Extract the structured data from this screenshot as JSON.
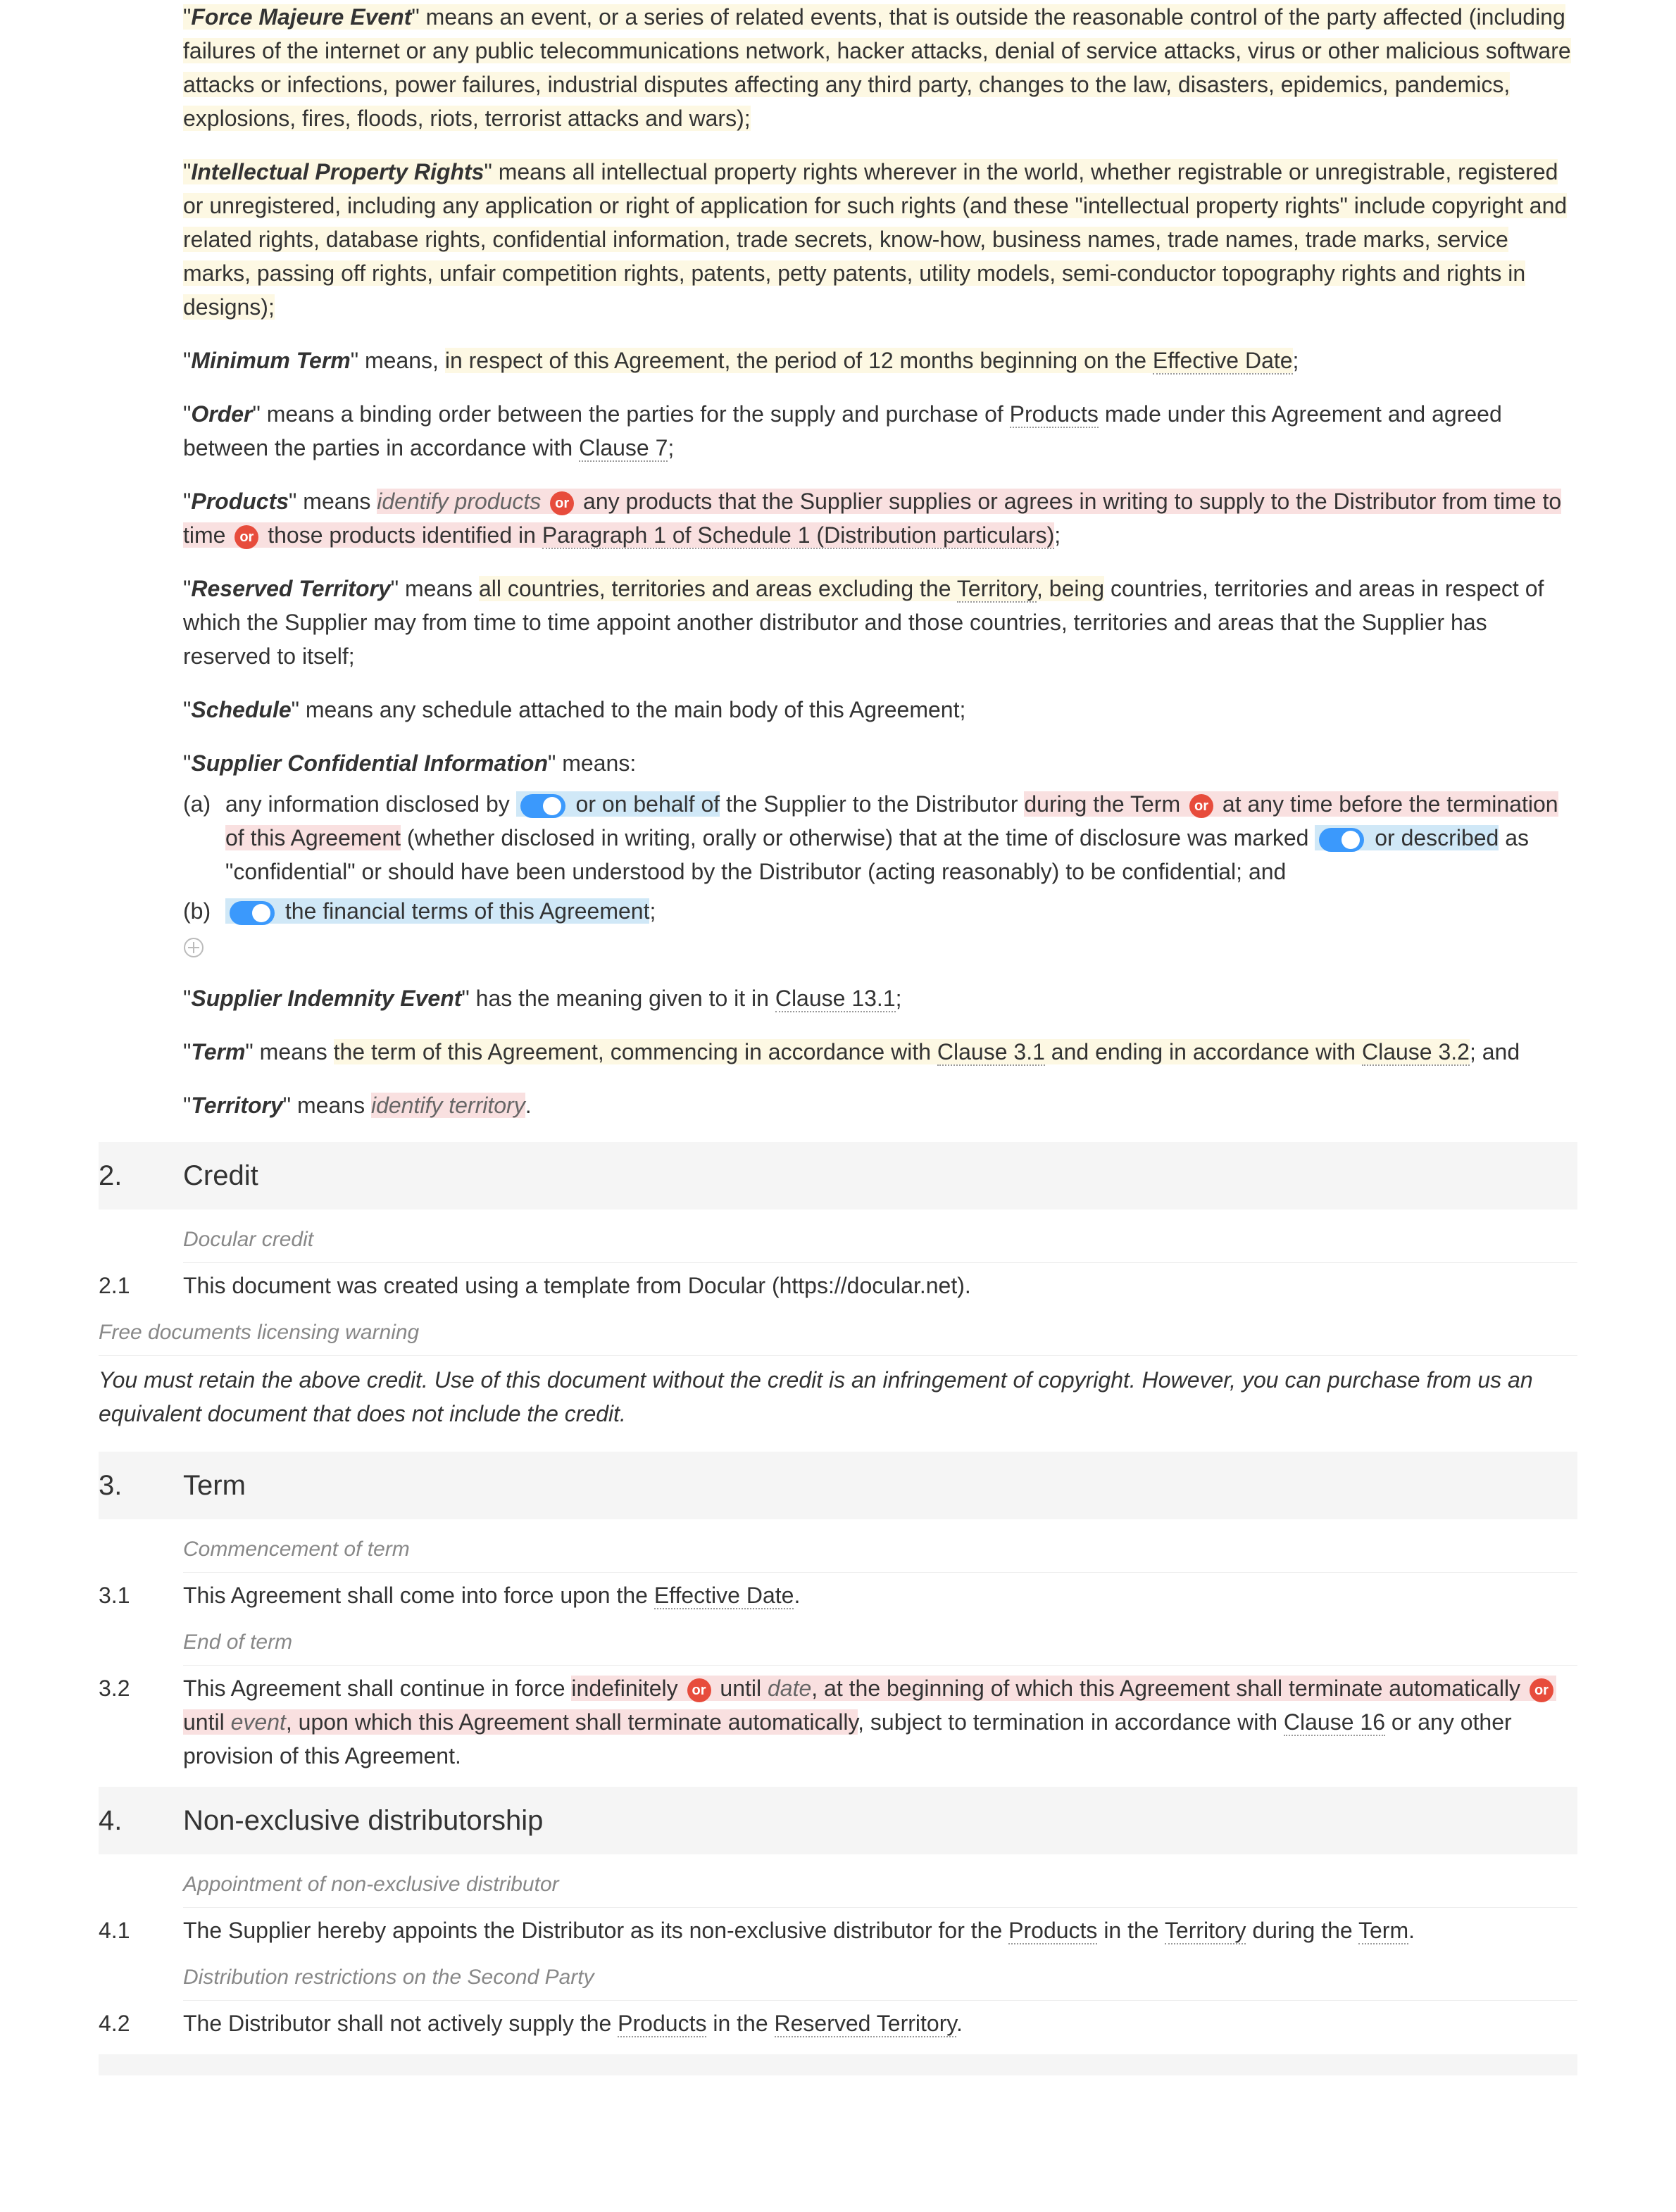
{
  "definitions": {
    "force_majeure": {
      "term": "Force Majeure Event",
      "body": "\" means an event, or a series of related events, that is outside the reasonable control of the party affected (including failures of the internet or any public telecommunications network, hacker attacks, denial of service attacks, virus or other malicious software attacks or infections, power failures, industrial disputes affecting any third party, changes to the law, disasters, epidemics, pandemics, explosions, fires, floods, riots, terrorist attacks and wars);"
    },
    "ip_rights": {
      "term": "Intellectual Property Rights",
      "body": "\" means all intellectual property rights wherever in the world, whether registrable or unregistrable, registered or unregistered, including any application or right of application for such rights (and these \"intellectual property rights\" include copyright and related rights, database rights, confidential information, trade secrets, know-how, business names, trade names, trade marks, service marks, passing off rights, unfair competition rights, patents, petty patents, utility models, semi-conductor topography rights and rights in designs);"
    },
    "minimum_term": {
      "term": "Minimum Term",
      "pre": "\" means, ",
      "hl": "in respect of this Agreement, the period of 12 months beginning on the ",
      "link": "Effective Date",
      "post": ";"
    },
    "order": {
      "term": "Order",
      "pre": "\" means a binding order between the parties for the supply and purchase of ",
      "link1": "Products",
      "mid": " made under this Agreement and agreed between the parties in accordance with ",
      "link2": "Clause 7",
      "post": ";"
    },
    "products": {
      "term": "Products",
      "pre": "\" means ",
      "field": "identify products",
      "opt1": " any products that the Supplier supplies or agrees in writing to supply to the Distributor from time to time ",
      "opt2a": " those products identified in ",
      "opt2link": "Paragraph 1 of Schedule 1 (Distribution particulars)",
      "post": ";"
    },
    "reserved_territory": {
      "term": "Reserved Territory",
      "pre": "\" means ",
      "hl_pre": "all countries, territories and areas excluding the ",
      "hl_link": "Territory",
      "hl_post": ", being",
      "rest": " countries, territories and areas in respect of which the Supplier may from time to time appoint another distributor and those countries, territories and areas that the Supplier has reserved to itself;"
    },
    "schedule": {
      "term": "Schedule",
      "body": "\" means any schedule attached to the main body of this Agreement;"
    },
    "supplier_ci": {
      "term": "Supplier Confidential Information",
      "pre": "\" means:",
      "a_pre": "any information disclosed by ",
      "a_t1": " or on behalf of",
      "a_mid1": " the Supplier to the Distributor ",
      "a_hl1": "during the Term ",
      "a_hl2a": " at any time before the termination of this Agreement",
      "a_mid2": " (whether disclosed in writing, orally or otherwise) that at the time of disclosure was marked ",
      "a_t2": " or described",
      "a_mid3": " as \"confidential\" or should have been understood by the Distributor (acting reasonably) to be confidential; and",
      "b_t": " the financial terms of this Agreement",
      "b_post": ";"
    },
    "supplier_indemnity": {
      "term": "Supplier Indemnity Event",
      "pre": "\" has the meaning given to it in ",
      "link": "Clause 13.1",
      "post": ";"
    },
    "term_def": {
      "term": "Term",
      "pre": "\" means ",
      "hl_pre": "the term of this Agreement, commencing in accordance with ",
      "hl_link1": "Clause 3.1",
      "hl_mid": " and ending in accordance with ",
      "hl_link2": "Clause 3.2",
      "post": "; and"
    },
    "territory": {
      "term": "Territory",
      "pre": "\" means ",
      "field": "identify territory",
      "post": "."
    }
  },
  "or_label": "or",
  "sections": {
    "s2": {
      "num": "2.",
      "title": "Credit",
      "note": "Docular credit",
      "c1num": "2.1",
      "c1": "This document was created using a template from Docular (https://docular.net).",
      "warn_title": "Free documents licensing warning",
      "warn_body": "You must retain the above credit. Use of this document without the credit is an infringement of copyright. However, you can purchase from us an equivalent document that does not include the credit."
    },
    "s3": {
      "num": "3.",
      "title": "Term",
      "note1": "Commencement of term",
      "c1num": "3.1",
      "c1_pre": "This Agreement shall come into force upon the ",
      "c1_link": "Effective Date",
      "c1_post": ".",
      "note2": "End of term",
      "c2num": "3.2",
      "c2_pre": "This Agreement shall continue in force ",
      "c2_hl1": "indefinitely ",
      "c2_opt_pre": " until ",
      "c2_opt_field": "date",
      "c2_opt_post": ", at the beginning of which this Agreement shall terminate automatically ",
      "c2_opt2_pre": " until ",
      "c2_opt2_field": "event",
      "c2_opt2_post": ", upon which this Agreement shall terminate automatically",
      "c2_rest_pre": ", subject to termination in accordance with ",
      "c2_rest_link": "Clause 16",
      "c2_rest_post": " or any other provision of this Agreement."
    },
    "s4": {
      "num": "4.",
      "title": "Non-exclusive distributorship",
      "note1": "Appointment of non-exclusive distributor",
      "c1num": "4.1",
      "c1_pre": "The Supplier hereby appoints the Distributor as its non-exclusive distributor for the ",
      "c1_link1": "Products",
      "c1_mid1": " in the ",
      "c1_link2": "Territory",
      "c1_mid2": " during the ",
      "c1_link3": "Term",
      "c1_post": ".",
      "note2": "Distribution restrictions on the Second Party",
      "c2num": "4.2",
      "c2_pre": "The Distributor shall not actively supply the ",
      "c2_link1": "Products",
      "c2_mid": " in the ",
      "c2_link2": "Reserved Territory",
      "c2_post": "."
    }
  },
  "list_markers": {
    "a": "(a)",
    "b": "(b)"
  }
}
